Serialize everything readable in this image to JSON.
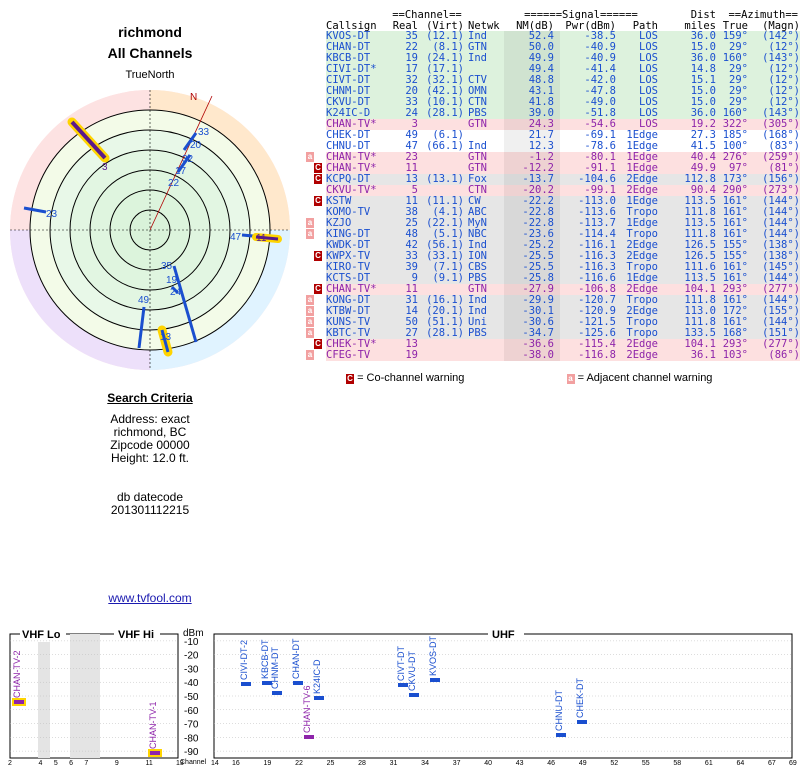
{
  "header": {
    "location": "richmond",
    "subtitle": "All Channels"
  },
  "polar": {
    "north_label": "TrueNorth",
    "n_label": "N"
  },
  "table": {
    "group_headers": [
      "==Channel==",
      "======Signal======",
      "Dist",
      "==Azimuth=="
    ],
    "col_headers": [
      "Callsign",
      "Real",
      "(Virt)",
      "Netwk",
      "NM(dB)",
      "Pwr(dBm)",
      "Path",
      "miles",
      "True",
      "(Magn)"
    ],
    "rows": [
      {
        "call": "KVOS-DT",
        "real": "35",
        "virt": "(12.1)",
        "net": "Ind",
        "nm": "52.4",
        "pwr": "-38.5",
        "path": "LOS",
        "dist": "36.0",
        "true": "159°",
        "magn": "(142°)",
        "bg": "#ddf2dd",
        "color": "#1a4fcf",
        "warn": ""
      },
      {
        "call": "CHAN-DT",
        "real": "22",
        "virt": "(8.1)",
        "net": "GTN",
        "nm": "50.0",
        "pwr": "-40.9",
        "path": "LOS",
        "dist": "15.0",
        "true": "29°",
        "magn": "(12°)",
        "bg": "#ddf2dd",
        "color": "#1a4fcf",
        "warn": ""
      },
      {
        "call": "KBCB-DT",
        "real": "19",
        "virt": "(24.1)",
        "net": "Ind",
        "nm": "49.9",
        "pwr": "-40.9",
        "path": "LOS",
        "dist": "36.0",
        "true": "160°",
        "magn": "(143°)",
        "bg": "#ddf2dd",
        "color": "#1a4fcf",
        "warn": ""
      },
      {
        "call": "CIVI-DT*",
        "real": "17",
        "virt": "(17.1)",
        "net": "",
        "nm": "49.4",
        "pwr": "-41.4",
        "path": "LOS",
        "dist": "14.8",
        "true": "29°",
        "magn": "(12°)",
        "bg": "#ddf2dd",
        "color": "#1a4fcf",
        "warn": ""
      },
      {
        "call": "CIVT-DT",
        "real": "32",
        "virt": "(32.1)",
        "net": "CTV",
        "nm": "48.8",
        "pwr": "-42.0",
        "path": "LOS",
        "dist": "15.1",
        "true": "29°",
        "magn": "(12°)",
        "bg": "#ddf2dd",
        "color": "#1a4fcf",
        "warn": ""
      },
      {
        "call": "CHNM-DT",
        "real": "20",
        "virt": "(42.1)",
        "net": "OMN",
        "nm": "43.1",
        "pwr": "-47.8",
        "path": "LOS",
        "dist": "15.0",
        "true": "29°",
        "magn": "(12°)",
        "bg": "#ddf2dd",
        "color": "#1a4fcf",
        "warn": ""
      },
      {
        "call": "CKVU-DT",
        "real": "33",
        "virt": "(10.1)",
        "net": "CTN",
        "nm": "41.8",
        "pwr": "-49.0",
        "path": "LOS",
        "dist": "15.0",
        "true": "29°",
        "magn": "(12°)",
        "bg": "#ddf2dd",
        "color": "#1a4fcf",
        "warn": ""
      },
      {
        "call": "K24IC-D",
        "real": "24",
        "virt": "(28.1)",
        "net": "PBS",
        "nm": "39.0",
        "pwr": "-51.8",
        "path": "LOS",
        "dist": "36.0",
        "true": "160°",
        "magn": "(143°)",
        "bg": "#ddf2dd",
        "color": "#1a4fcf",
        "warn": ""
      },
      {
        "call": "CHAN-TV*",
        "real": "3",
        "virt": "",
        "net": "GTN",
        "nm": "24.3",
        "pwr": "-54.6",
        "path": "LOS",
        "dist": "19.2",
        "true": "322°",
        "magn": "(305°)",
        "bg": "#fde0e0",
        "color": "#8e24aa",
        "warn": ""
      },
      {
        "call": "CHEK-DT",
        "real": "49",
        "virt": "(6.1)",
        "net": "",
        "nm": "21.7",
        "pwr": "-69.1",
        "path": "1Edge",
        "dist": "27.3",
        "true": "185°",
        "magn": "(168°)",
        "bg": "#ffffff",
        "color": "#1a4fcf",
        "warn": ""
      },
      {
        "call": "CHNU-DT",
        "real": "47",
        "virt": "(66.1)",
        "net": "Ind",
        "nm": "12.3",
        "pwr": "-78.6",
        "path": "1Edge",
        "dist": "41.5",
        "true": "100°",
        "magn": "(83°)",
        "bg": "#ffffff",
        "color": "#1a4fcf",
        "warn": ""
      },
      {
        "call": "CHAN-TV*",
        "real": "23",
        "virt": "",
        "net": "GTN",
        "nm": "-1.2",
        "pwr": "-80.1",
        "path": "1Edge",
        "dist": "40.4",
        "true": "276°",
        "magn": "(259°)",
        "bg": "#fde0e0",
        "color": "#8e24aa",
        "warn": "a"
      },
      {
        "call": "CHAN-TV*",
        "real": "11",
        "virt": "",
        "net": "GTN",
        "nm": "-12.2",
        "pwr": "-91.1",
        "path": "1Edge",
        "dist": "49.9",
        "true": "97°",
        "magn": "(81°)",
        "bg": "#fde0e0",
        "color": "#8e24aa",
        "warn": "C"
      },
      {
        "call": "KCPQ-DT",
        "real": "13",
        "virt": "(13.1)",
        "net": "Fox",
        "nm": "-13.7",
        "pwr": "-104.6",
        "path": "2Edge",
        "dist": "112.8",
        "true": "173°",
        "magn": "(156°)",
        "bg": "#e6e6e6",
        "color": "#1a4fcf",
        "warn": "C"
      },
      {
        "call": "CKVU-TV*",
        "real": "5",
        "virt": "",
        "net": "CTN",
        "nm": "-20.2",
        "pwr": "-99.1",
        "path": "2Edge",
        "dist": "90.4",
        "true": "290°",
        "magn": "(273°)",
        "bg": "#fde0e0",
        "color": "#8e24aa",
        "warn": ""
      },
      {
        "call": "KSTW",
        "real": "11",
        "virt": "(11.1)",
        "net": "CW",
        "nm": "-22.2",
        "pwr": "-113.0",
        "path": "1Edge",
        "dist": "113.5",
        "true": "161°",
        "magn": "(144°)",
        "bg": "#e6e6e6",
        "color": "#1a4fcf",
        "warn": "C"
      },
      {
        "call": "KOMO-TV",
        "real": "38",
        "virt": "(4.1)",
        "net": "ABC",
        "nm": "-22.8",
        "pwr": "-113.6",
        "path": "Tropo",
        "dist": "111.8",
        "true": "161°",
        "magn": "(144°)",
        "bg": "#e6e6e6",
        "color": "#1a4fcf",
        "warn": ""
      },
      {
        "call": "KZJO",
        "real": "25",
        "virt": "(22.1)",
        "net": "MyN",
        "nm": "-22.8",
        "pwr": "-113.7",
        "path": "1Edge",
        "dist": "113.5",
        "true": "161°",
        "magn": "(144°)",
        "bg": "#e6e6e6",
        "color": "#1a4fcf",
        "warn": "a"
      },
      {
        "call": "KING-DT",
        "real": "48",
        "virt": "(5.1)",
        "net": "NBC",
        "nm": "-23.6",
        "pwr": "-114.4",
        "path": "Tropo",
        "dist": "111.8",
        "true": "161°",
        "magn": "(144°)",
        "bg": "#e6e6e6",
        "color": "#1a4fcf",
        "warn": "a"
      },
      {
        "call": "KWDK-DT",
        "real": "42",
        "virt": "(56.1)",
        "net": "Ind",
        "nm": "-25.2",
        "pwr": "-116.1",
        "path": "2Edge",
        "dist": "126.5",
        "true": "155°",
        "magn": "(138°)",
        "bg": "#e6e6e6",
        "color": "#1a4fcf",
        "warn": ""
      },
      {
        "call": "KWPX-TV",
        "real": "33",
        "virt": "(33.1)",
        "net": "ION",
        "nm": "-25.5",
        "pwr": "-116.3",
        "path": "2Edge",
        "dist": "126.5",
        "true": "155°",
        "magn": "(138°)",
        "bg": "#e6e6e6",
        "color": "#1a4fcf",
        "warn": "C"
      },
      {
        "call": "KIRO-TV",
        "real": "39",
        "virt": "(7.1)",
        "net": "CBS",
        "nm": "-25.5",
        "pwr": "-116.3",
        "path": "Tropo",
        "dist": "111.6",
        "true": "161°",
        "magn": "(145°)",
        "bg": "#e6e6e6",
        "color": "#1a4fcf",
        "warn": ""
      },
      {
        "call": "KCTS-DT",
        "real": "9",
        "virt": "(9.1)",
        "net": "PBS",
        "nm": "-25.8",
        "pwr": "-116.6",
        "path": "1Edge",
        "dist": "113.5",
        "true": "161°",
        "magn": "(144°)",
        "bg": "#e6e6e6",
        "color": "#1a4fcf",
        "warn": ""
      },
      {
        "call": "CHAN-TV*",
        "real": "11",
        "virt": "",
        "net": "GTN",
        "nm": "-27.9",
        "pwr": "-106.8",
        "path": "2Edge",
        "dist": "104.1",
        "true": "293°",
        "magn": "(277°)",
        "bg": "#fde0e0",
        "color": "#8e24aa",
        "warn": "C"
      },
      {
        "call": "KONG-DT",
        "real": "31",
        "virt": "(16.1)",
        "net": "Ind",
        "nm": "-29.9",
        "pwr": "-120.7",
        "path": "Tropo",
        "dist": "111.8",
        "true": "161°",
        "magn": "(144°)",
        "bg": "#e6e6e6",
        "color": "#1a4fcf",
        "warn": "a"
      },
      {
        "call": "KTBW-DT",
        "real": "14",
        "virt": "(20.1)",
        "net": "Ind",
        "nm": "-30.1",
        "pwr": "-120.9",
        "path": "2Edge",
        "dist": "113.0",
        "true": "172°",
        "magn": "(155°)",
        "bg": "#e6e6e6",
        "color": "#1a4fcf",
        "warn": "a"
      },
      {
        "call": "KUNS-TV",
        "real": "50",
        "virt": "(51.1)",
        "net": "Uni",
        "nm": "-30.6",
        "pwr": "-121.5",
        "path": "Tropo",
        "dist": "111.8",
        "true": "161°",
        "magn": "(144°)",
        "bg": "#e6e6e6",
        "color": "#1a4fcf",
        "warn": "a"
      },
      {
        "call": "KBTC-TV",
        "real": "27",
        "virt": "(28.1)",
        "net": "PBS",
        "nm": "-34.7",
        "pwr": "-125.6",
        "path": "Tropo",
        "dist": "133.5",
        "true": "168°",
        "magn": "(151°)",
        "bg": "#e6e6e6",
        "color": "#1a4fcf",
        "warn": "a"
      },
      {
        "call": "CHEK-TV*",
        "real": "13",
        "virt": "",
        "net": "",
        "nm": "-36.6",
        "pwr": "-115.4",
        "path": "2Edge",
        "dist": "104.1",
        "true": "293°",
        "magn": "(277°)",
        "bg": "#fde0e0",
        "color": "#8e24aa",
        "warn": "C"
      },
      {
        "call": "CFEG-TV",
        "real": "19",
        "virt": "",
        "net": "",
        "nm": "-38.0",
        "pwr": "-116.8",
        "path": "2Edge",
        "dist": "36.1",
        "true": "103°",
        "magn": "(86°)",
        "bg": "#fde0e0",
        "color": "#8e24aa",
        "warn": "a"
      }
    ]
  },
  "legend": {
    "co_icon": "C",
    "co_text": "= Co-channel warning",
    "adj_icon": "a",
    "adj_text": "= Adjacent channel warning"
  },
  "criteria": {
    "heading": "Search Criteria",
    "address": "Address: exact",
    "city": "richmond, BC",
    "zip": "Zipcode 00000",
    "height": "Height: 12.0 ft.",
    "db_label": "db datecode",
    "db_code": "201301112215"
  },
  "link": "www.tvfool.com",
  "bottom": {
    "vhf_lo": "VHF Lo",
    "vhf_hi": "VHF Hi",
    "uhf": "UHF",
    "dbm": "dBm",
    "channel": "Channel",
    "dbm_ticks": [
      "-10",
      "-20",
      "-30",
      "-40",
      "-50",
      "-60",
      "-70",
      "-80",
      "-90"
    ],
    "vhf_ticks": [
      "2",
      "4",
      "5",
      "6",
      "7",
      "9",
      "11",
      "13"
    ],
    "uhf_ticks": [
      "14",
      "16",
      "19",
      "22",
      "25",
      "28",
      "31",
      "34",
      "37",
      "40",
      "43",
      "46",
      "49",
      "52",
      "55",
      "58",
      "61",
      "64",
      "67",
      "69"
    ]
  },
  "colors": {
    "blue": "#1a4fcf",
    "purple": "#8e24aa",
    "grey_band": "#e4e4e4",
    "green_row": "#ddf2dd",
    "pink_row": "#fde0e0",
    "warn_red": "#b00000",
    "warn_pink": "#f2a0a0"
  }
}
